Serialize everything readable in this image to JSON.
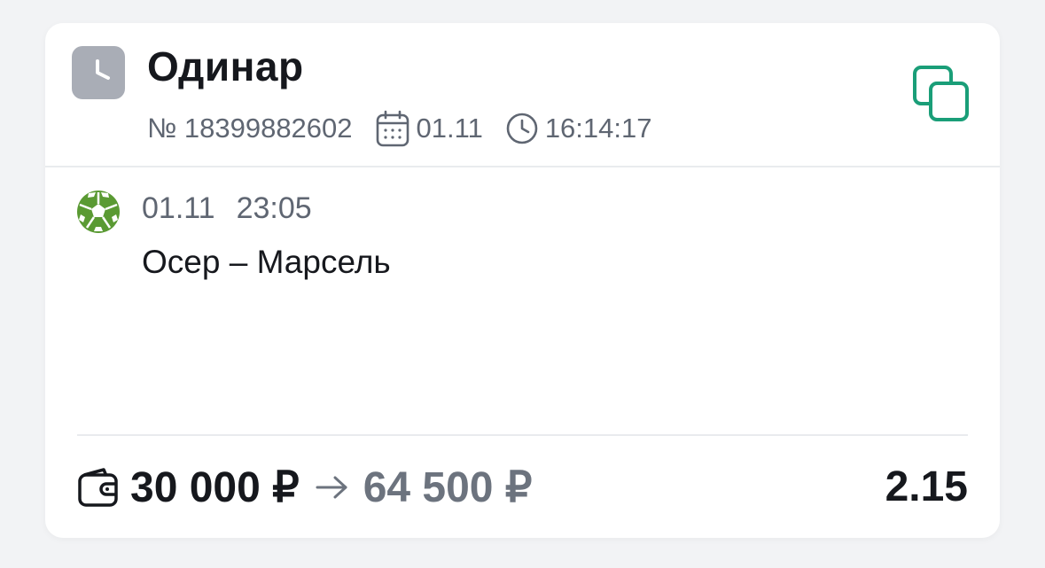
{
  "bet": {
    "type": "Одинар",
    "number": "№ 18399882602",
    "date": "01.11",
    "time": "16:14:17",
    "status_icon": "clock-icon"
  },
  "event": {
    "date": "01.11",
    "time": "23:05",
    "name": "Осер – Марсель",
    "sport_icon": "soccer-ball-icon"
  },
  "footer": {
    "stake": "30 000 ₽",
    "payout": "64 500 ₽",
    "odds": "2.15"
  },
  "colors": {
    "accent": "#1a9e78",
    "ball": "#5a9a33",
    "badge": "#a9adb6"
  }
}
